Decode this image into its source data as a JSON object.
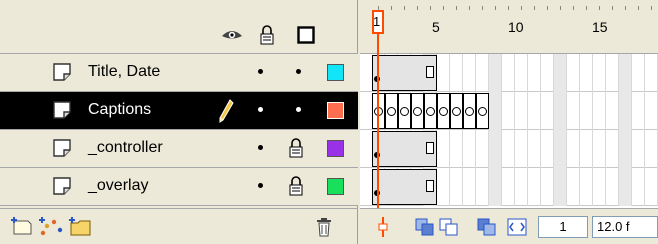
{
  "layers": [
    {
      "name": "Title, Date",
      "selected": false,
      "locked": false,
      "color": "#11e5f7"
    },
    {
      "name": "Captions",
      "selected": true,
      "locked": false,
      "color": "#ff6f4f",
      "editing": true
    },
    {
      "name": "_controller",
      "selected": false,
      "locked": true,
      "color": "#9932e6"
    },
    {
      "name": "_overlay",
      "selected": false,
      "locked": true,
      "color": "#18e05a"
    }
  ],
  "ruler": {
    "labels": [
      "1",
      "5",
      "10",
      "15"
    ]
  },
  "playhead": {
    "frame": "1"
  },
  "footer": {
    "current_frame": "1",
    "frame_rate": "12.0 f"
  },
  "colors": {
    "playhead": "#ff4b00",
    "selected_row": "#000000",
    "panel_bg": "#ece9d8"
  }
}
